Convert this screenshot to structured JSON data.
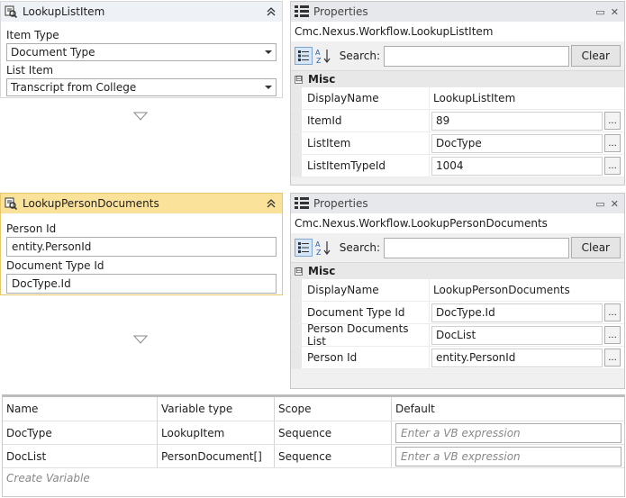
{
  "activities": [
    {
      "title": "LookupListItem",
      "fields": [
        {
          "label": "Item Type",
          "value": "Document Type"
        },
        {
          "label": "List Item",
          "value": "Transcript from College"
        }
      ]
    },
    {
      "title": "LookupPersonDocuments",
      "fields": [
        {
          "label": "Person Id",
          "value": "entity.PersonId"
        },
        {
          "label": "Document Type Id",
          "value": "DocType.Id"
        }
      ]
    }
  ],
  "panels": [
    {
      "title": "Properties",
      "type_name": "Cmc.Nexus.Workflow.LookupListItem",
      "search_label": "Search:",
      "clear_label": "Clear",
      "category": "Misc",
      "rows": [
        {
          "name": "DisplayName",
          "value": "LookupListItem"
        },
        {
          "name": "ItemId",
          "value": "89"
        },
        {
          "name": "ListItem",
          "value": "DocType"
        },
        {
          "name": "ListItemTypeId",
          "value": "1004"
        }
      ]
    },
    {
      "title": "Properties",
      "type_name": "Cmc.Nexus.Workflow.LookupPersonDocuments",
      "search_label": "Search:",
      "clear_label": "Clear",
      "category": "Misc",
      "rows": [
        {
          "name": "DisplayName",
          "value": "LookupPersonDocuments"
        },
        {
          "name": "Document Type Id",
          "value": "DocType.Id"
        },
        {
          "name": "Person Documents List",
          "value": "DocList"
        },
        {
          "name": "Person Id",
          "value": "entity.PersonId"
        }
      ]
    }
  ],
  "variables": {
    "headers": [
      "Name",
      "Variable type",
      "Scope",
      "Default"
    ],
    "rows": [
      {
        "name": "DocType",
        "type": "LookupItem",
        "scope": "Sequence",
        "default_placeholder": "Enter a VB expression"
      },
      {
        "name": "DocList",
        "type": "PersonDocument[]",
        "scope": "Sequence",
        "default_placeholder": "Enter a VB expression"
      }
    ],
    "create_label": "Create Variable"
  },
  "ellipsis": "...",
  "collapse_glyph": "⊟",
  "panel_controls": {
    "minimize": "▭",
    "close": "✕"
  },
  "icons": {
    "activity": "lookup-activity-icon",
    "properties": "properties-grid-icon",
    "categorized": "categorized-icon",
    "alphabetical": "alphabetical-sort-icon",
    "collapse": "double-chevron-up-icon",
    "flow": "triangle-down-icon"
  }
}
